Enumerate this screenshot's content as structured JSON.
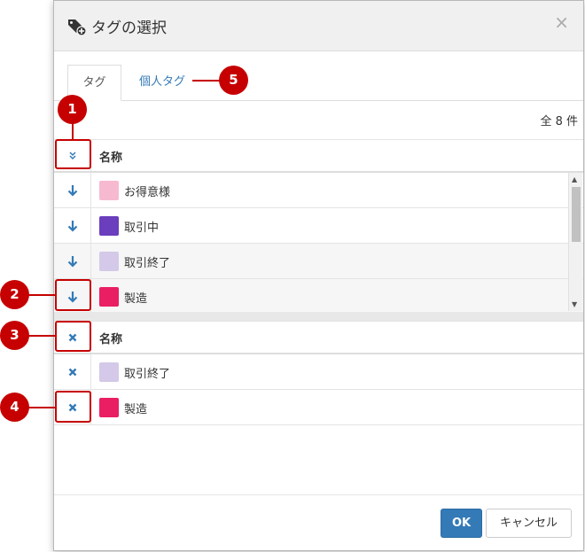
{
  "dialog": {
    "title": "タグの選択",
    "close_label": "×"
  },
  "tabs": [
    {
      "label": "タグ",
      "active": true
    },
    {
      "label": "個人タグ",
      "active": false
    }
  ],
  "count_label": "全 8 件",
  "available_table": {
    "header_label": "名称",
    "header_icon": "double-chevron-down-icon",
    "rows": [
      {
        "name": "お得意様",
        "color": "#f7b9d0",
        "icon": "arrow-down-icon"
      },
      {
        "name": "取引中",
        "color": "#6a3ebd",
        "icon": "arrow-down-icon"
      },
      {
        "name": "取引終了",
        "color": "#d4c9e8",
        "icon": "arrow-down-icon"
      },
      {
        "name": "製造",
        "color": "#e91e63",
        "icon": "arrow-down-icon"
      }
    ]
  },
  "selected_table": {
    "header_label": "名称",
    "header_icon": "remove-icon",
    "rows": [
      {
        "name": "取引終了",
        "color": "#d4c9e8",
        "icon": "remove-icon"
      },
      {
        "name": "製造",
        "color": "#e91e63",
        "icon": "remove-icon"
      }
    ]
  },
  "footer": {
    "ok_label": "OK",
    "cancel_label": "キャンセル"
  },
  "callouts": [
    "1",
    "2",
    "3",
    "4",
    "5"
  ],
  "colors": {
    "accent": "#337ab7",
    "callout": "#c60000"
  }
}
